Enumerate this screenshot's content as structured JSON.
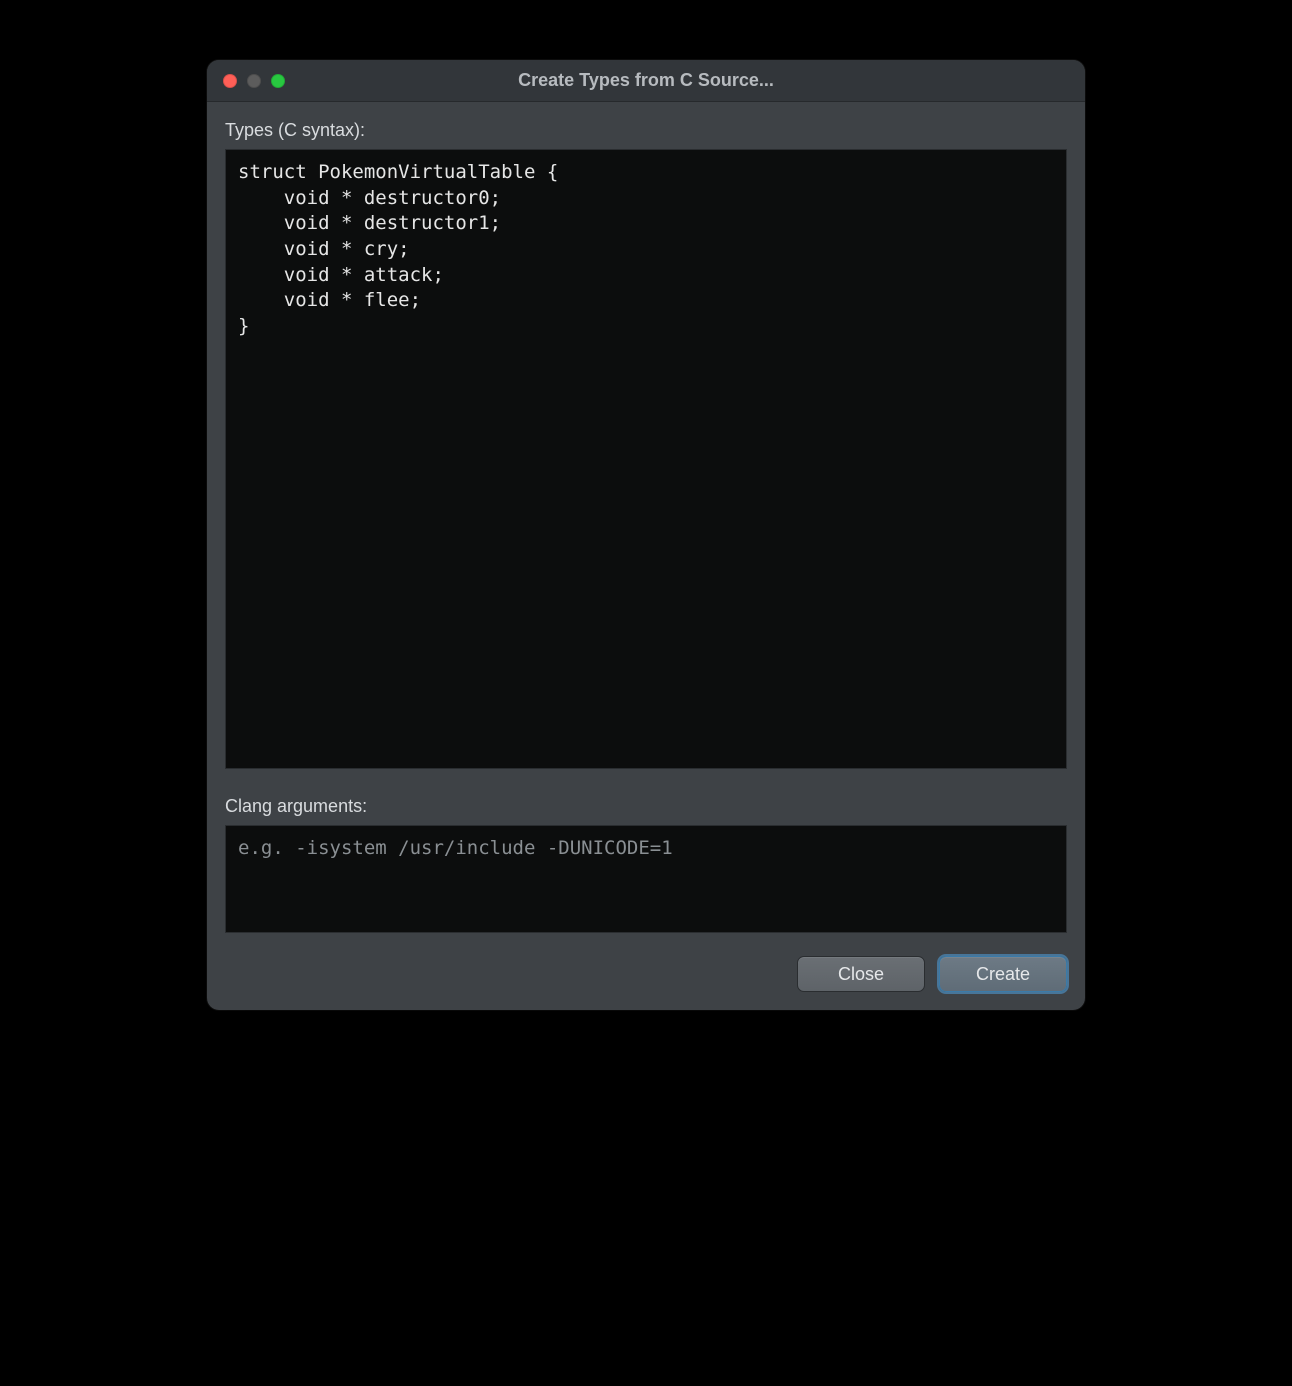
{
  "window": {
    "title": "Create Types from C Source..."
  },
  "sections": {
    "types_label": "Types (C syntax):",
    "clang_label": "Clang arguments:"
  },
  "inputs": {
    "types_value": "struct PokemonVirtualTable {\n    void * destructor0;\n    void * destructor1;\n    void * cry;\n    void * attack;\n    void * flee;\n}",
    "clang_value": "",
    "clang_placeholder": "e.g. -isystem /usr/include -DUNICODE=1"
  },
  "buttons": {
    "close_label": "Close",
    "create_label": "Create"
  }
}
